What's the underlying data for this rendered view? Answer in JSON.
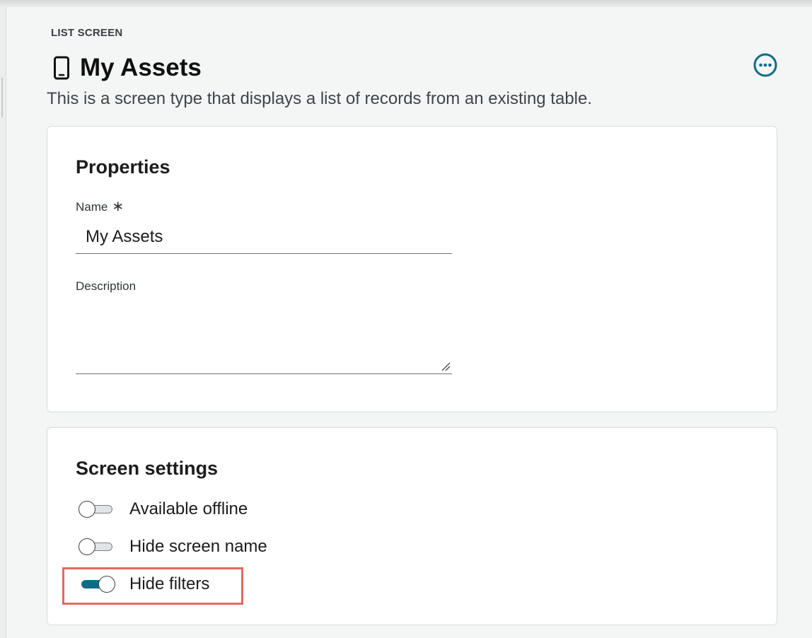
{
  "header": {
    "eyebrow": "LIST SCREEN",
    "title": "My Assets",
    "title_icon": "mobile-device-icon",
    "more_icon": "more-options-icon",
    "subtitle": "This is a screen type that displays a list of records from an existing table."
  },
  "properties": {
    "heading": "Properties",
    "name_label": "Name",
    "name_required_mark": "∗",
    "name_value": "My Assets",
    "description_label": "Description",
    "description_value": ""
  },
  "screen_settings": {
    "heading": "Screen settings",
    "toggles": [
      {
        "label": "Available offline",
        "on": false
      },
      {
        "label": "Hide screen name",
        "on": false
      },
      {
        "label": "Hide filters",
        "on": true
      }
    ]
  },
  "colors": {
    "accent": "#0e6d86",
    "highlight": "#e46a5e"
  }
}
